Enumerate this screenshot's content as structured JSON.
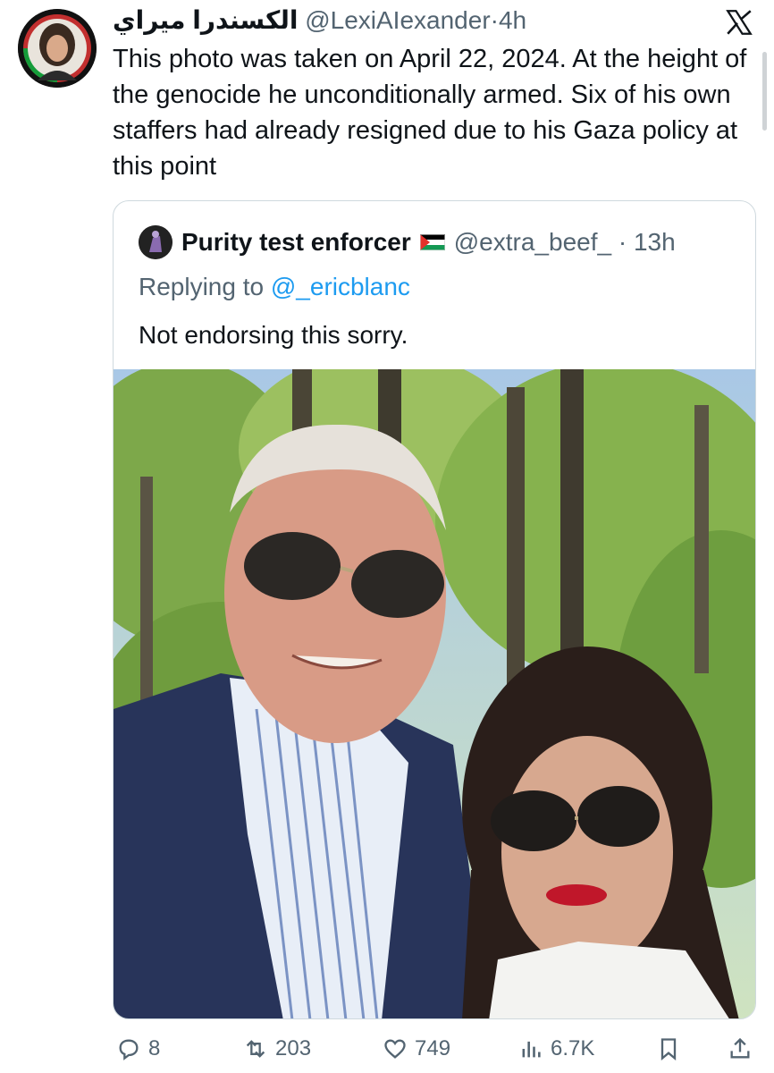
{
  "tweet": {
    "author_name": "الكسندرا ميراي",
    "author_handle": "@LexiAIexander",
    "separator": "·",
    "time": "4h",
    "text": "This photo was taken on April 22, 2024. At the height of the genocide he unconditionally armed. Six of his own staffers had already resigned due to his Gaza policy at this point"
  },
  "quoted": {
    "author_name": "Purity test enforcer",
    "flag_icon": "palestine-flag-icon",
    "author_handle": "@extra_beef_",
    "separator": "·",
    "time": "13h",
    "reply_prefix": "Replying to",
    "reply_mention": "@_ericblanc",
    "text": "Not endorsing this sorry."
  },
  "actions": {
    "replies": "8",
    "reposts": "203",
    "likes": "749",
    "views": "6.7K"
  },
  "colors": {
    "accent": "#1d9bf0",
    "muted": "#536471",
    "text": "#0f1419",
    "border": "#cfd9de"
  }
}
